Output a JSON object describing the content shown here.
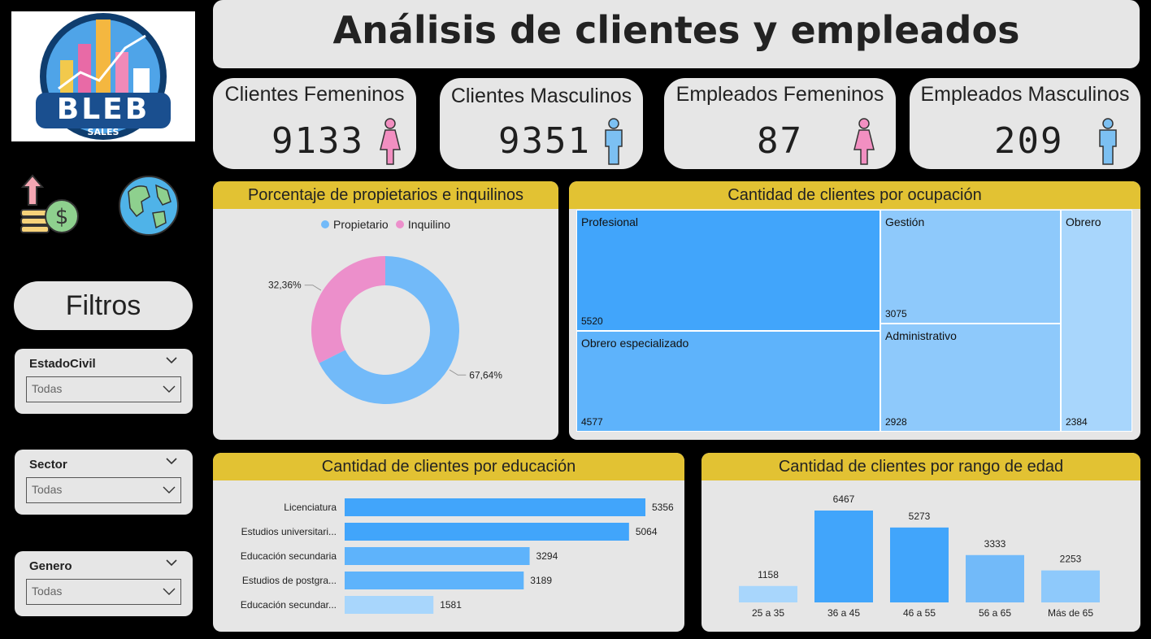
{
  "header": {
    "title": "Análisis de clientes y empleados"
  },
  "logo": {
    "text": "BLEB",
    "sub": "SALES"
  },
  "filters": {
    "title": "Filtros",
    "slicers": [
      {
        "label": "EstadoCivil",
        "value": "Todas"
      },
      {
        "label": "Sector",
        "value": "Todas"
      },
      {
        "label": "Genero",
        "value": "Todas"
      }
    ]
  },
  "kpis": [
    {
      "label": "Clientes Femeninos",
      "value": "9133",
      "icon": "female-icon",
      "color": "#f28fc1"
    },
    {
      "label": "Clientes Masculinos",
      "value": "9351",
      "icon": "male-icon",
      "color": "#7cc0f2"
    },
    {
      "label": "Empleados Femeninos",
      "value": "87",
      "icon": "female-icon",
      "color": "#f28fc1"
    },
    {
      "label": "Empleados Masculinos",
      "value": "209",
      "icon": "male-icon",
      "color": "#7cc0f2"
    }
  ],
  "colors": {
    "accent": "#e2c233",
    "panel": "#e6e6e6",
    "blue_dark": "#41a5fb",
    "blue_mid": "#5eb3fb",
    "blue_light": "#8ec9fb",
    "blue_lighter": "#a8d6fc",
    "pink": "#ec8fcb"
  },
  "donut": {
    "title": "Porcentaje de propietarios e inquilinos",
    "legend": [
      {
        "name": "Propietario",
        "color": "#72baf9"
      },
      {
        "name": "Inquilino",
        "color": "#ec8fcb"
      }
    ],
    "chart_data": {
      "type": "pie",
      "categories": [
        "Propietario",
        "Inquilino"
      ],
      "values": [
        67.64,
        32.36
      ],
      "labels": [
        "67,64%",
        "32,36%"
      ]
    }
  },
  "treemap": {
    "title": "Cantidad de clientes por ocupación",
    "chart_data": {
      "type": "treemap",
      "categories": [
        "Profesional",
        "Obrero especializado",
        "Gestión",
        "Administrativo",
        "Obrero"
      ],
      "values": [
        5520,
        4577,
        3075,
        2928,
        2384
      ]
    }
  },
  "education": {
    "title": "Cantidad de clientes por educación",
    "chart_data": {
      "type": "bar",
      "orientation": "horizontal",
      "categories": [
        "Licenciatura",
        "Estudios universitari...",
        "Educación secundaria",
        "Estudios de postgra...",
        "Educación secundar..."
      ],
      "values": [
        5356,
        5064,
        3294,
        3189,
        1581
      ],
      "xlim": [
        0,
        5356
      ]
    }
  },
  "age": {
    "title": "Cantidad de clientes por rango de edad",
    "chart_data": {
      "type": "bar",
      "categories": [
        "25 a 35",
        "36 a 45",
        "46 a 55",
        "56 a 65",
        "Más de 65"
      ],
      "values": [
        1158,
        6467,
        5273,
        3333,
        2253
      ],
      "ylim": [
        0,
        6467
      ]
    }
  }
}
